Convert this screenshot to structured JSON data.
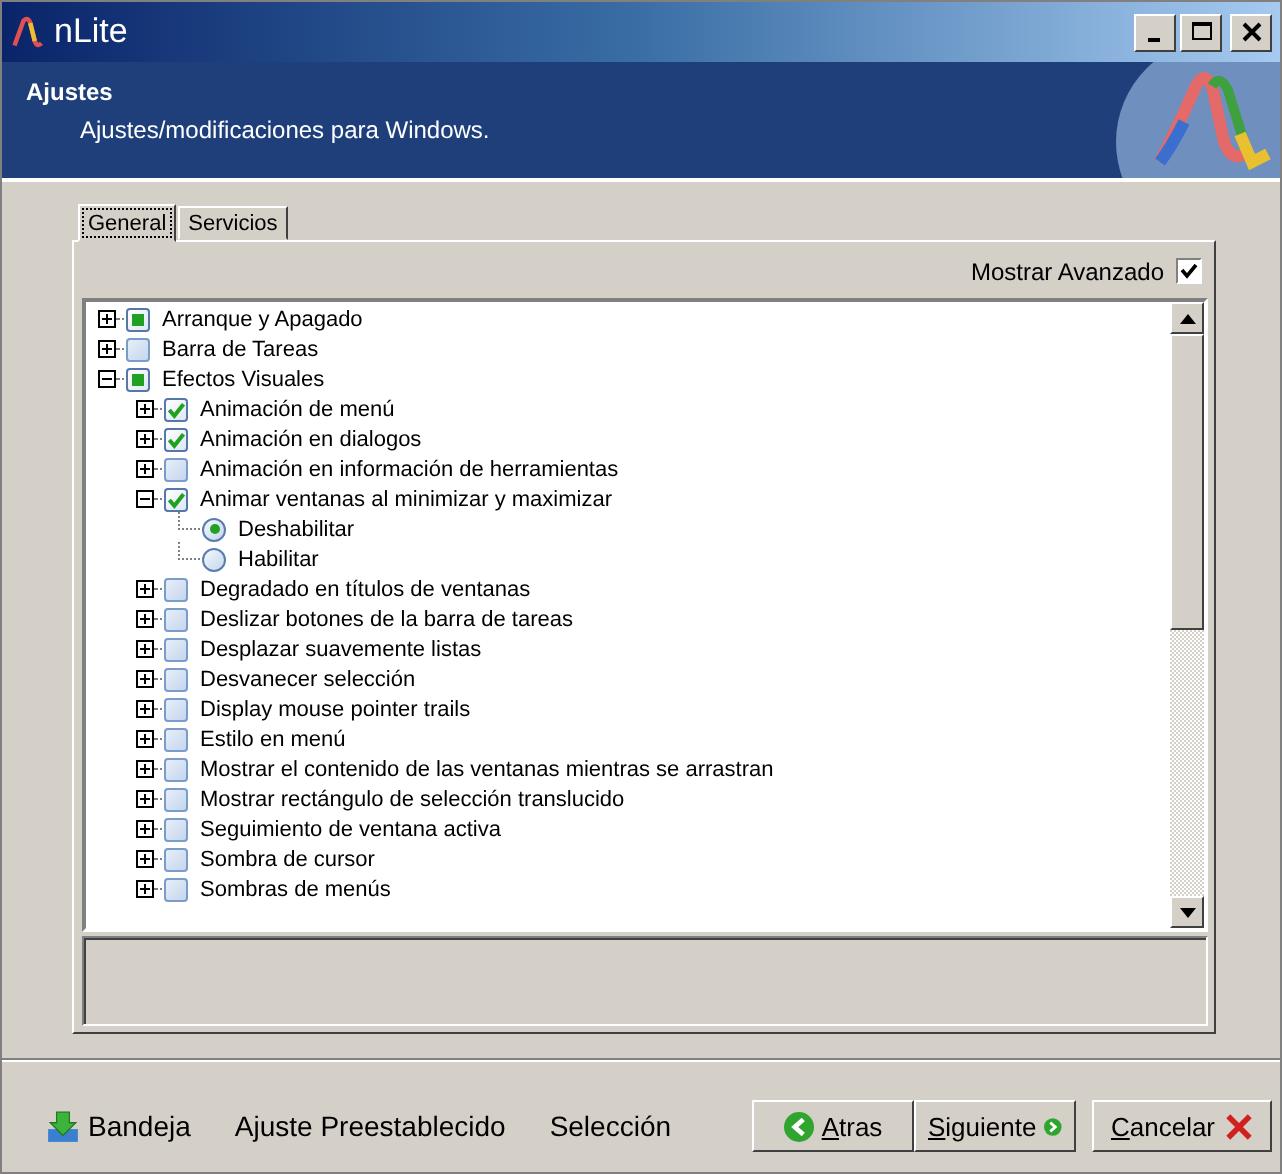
{
  "window": {
    "title": "nLite"
  },
  "header": {
    "title": "Ajustes",
    "subtitle": "Ajustes/modificaciones para Windows."
  },
  "tabs": [
    {
      "label": "General",
      "selected": true
    },
    {
      "label": "Servicios",
      "selected": false
    }
  ],
  "show_advanced": {
    "label": "Mostrar Avanzado",
    "checked": true
  },
  "tree": [
    {
      "kind": "check",
      "label": "Arranque y Apagado",
      "checked": true,
      "partial": true,
      "expanded": false
    },
    {
      "kind": "check",
      "label": "Barra de Tareas",
      "checked": false,
      "partial": false,
      "expanded": false
    },
    {
      "kind": "check",
      "label": "Efectos Visuales",
      "checked": true,
      "partial": true,
      "expanded": true,
      "children": [
        {
          "kind": "check",
          "label": "Animación de menú",
          "checked": true,
          "partial": false,
          "expanded": false
        },
        {
          "kind": "check",
          "label": "Animación en dialogos",
          "checked": true,
          "partial": false,
          "expanded": false
        },
        {
          "kind": "check",
          "label": "Animación en información de herramientas",
          "checked": false,
          "partial": false,
          "expanded": false
        },
        {
          "kind": "check",
          "label": "Animar ventanas al minimizar y maximizar",
          "checked": true,
          "partial": false,
          "expanded": true,
          "children": [
            {
              "kind": "radio",
              "label": "Deshabilitar",
              "selected": true
            },
            {
              "kind": "radio",
              "label": "Habilitar",
              "selected": false
            }
          ]
        },
        {
          "kind": "check",
          "label": "Degradado en títulos de ventanas",
          "checked": false,
          "partial": false,
          "expanded": false
        },
        {
          "kind": "check",
          "label": "Deslizar botones de la barra de tareas",
          "checked": false,
          "partial": false,
          "expanded": false
        },
        {
          "kind": "check",
          "label": "Desplazar suavemente listas",
          "checked": false,
          "partial": false,
          "expanded": false
        },
        {
          "kind": "check",
          "label": "Desvanecer selección",
          "checked": false,
          "partial": false,
          "expanded": false
        },
        {
          "kind": "check",
          "label": "Display mouse pointer trails",
          "checked": false,
          "partial": false,
          "expanded": false
        },
        {
          "kind": "check",
          "label": "Estilo en menú",
          "checked": false,
          "partial": false,
          "expanded": false
        },
        {
          "kind": "check",
          "label": "Mostrar el contenido de las ventanas mientras se arrastran",
          "checked": false,
          "partial": false,
          "expanded": false
        },
        {
          "kind": "check",
          "label": "Mostrar rectángulo de selección translucido",
          "checked": false,
          "partial": false,
          "expanded": false
        },
        {
          "kind": "check",
          "label": "Seguimiento de ventana activa",
          "checked": false,
          "partial": false,
          "expanded": false
        },
        {
          "kind": "check",
          "label": "Sombra de cursor",
          "checked": false,
          "partial": false,
          "expanded": false
        },
        {
          "kind": "check",
          "label": "Sombras de menús",
          "checked": false,
          "partial": false,
          "expanded": false
        }
      ]
    }
  ],
  "footer_links": [
    {
      "kind": "tray",
      "label": "Bandeja"
    },
    {
      "kind": "plain",
      "label": "Ajuste Preestablecido"
    },
    {
      "kind": "plain",
      "label": "Selección"
    }
  ],
  "buttons": [
    {
      "kind": "back",
      "label": "Atras"
    },
    {
      "kind": "next",
      "label": "Siguiente"
    },
    {
      "kind": "cancel",
      "label": "Cancelar"
    }
  ]
}
